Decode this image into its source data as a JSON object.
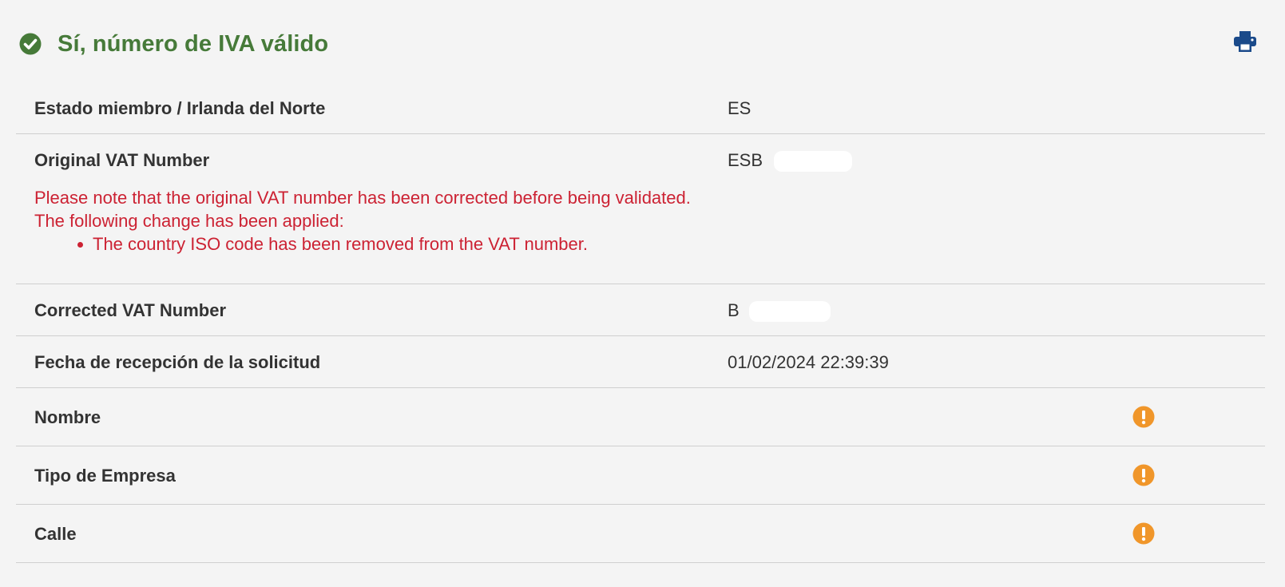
{
  "header": {
    "title": "Sí, número de IVA válido",
    "status_icon": "check-circle-icon",
    "status_color": "#467a39",
    "print_icon": "printer-icon",
    "print_color": "#1a4a8a"
  },
  "rows": [
    {
      "label": "Estado miembro / Irlanda del Norte",
      "value": "ES"
    },
    {
      "label": "Original VAT Number",
      "value": "ESB"
    },
    {
      "label": "Corrected VAT Number",
      "value": "B"
    },
    {
      "label": "Fecha de recepción de la solicitud",
      "value": "01/02/2024 22:39:39"
    },
    {
      "label": "Nombre",
      "value": "",
      "icon": "warning-icon"
    },
    {
      "label": "Tipo de Empresa",
      "value": "",
      "icon": "warning-icon"
    },
    {
      "label": "Calle",
      "value": "",
      "icon": "warning-icon"
    }
  ],
  "notice": {
    "line1": "Please note that the original VAT number has been corrected before being validated.",
    "line2": "The following change has been applied:",
    "items": [
      "The country ISO code has been removed from the VAT number."
    ],
    "color": "#cc2233"
  },
  "warning_color": "#f0962a"
}
